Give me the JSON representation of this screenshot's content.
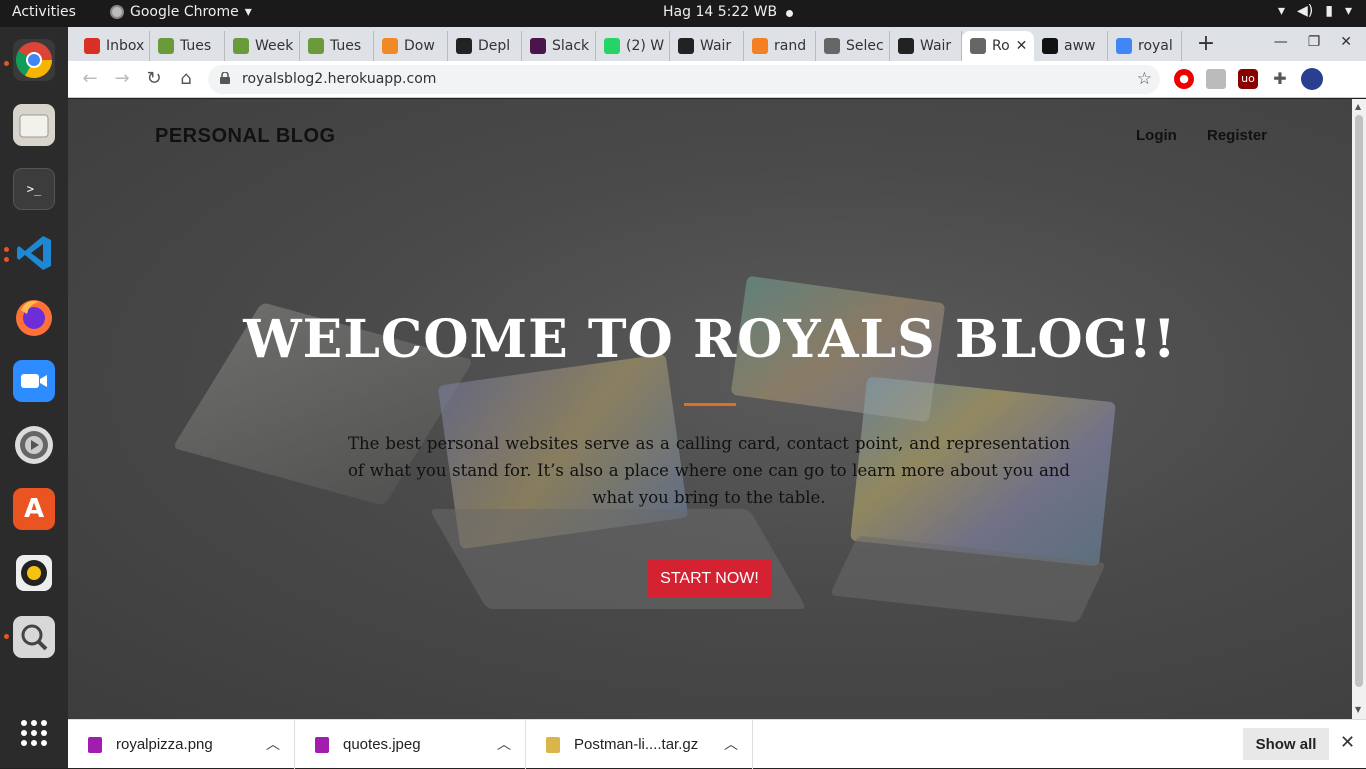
{
  "topbar": {
    "activities": "Activities",
    "app_name": "Google Chrome",
    "clock": "Hag 14   5:22 WB"
  },
  "dock": {
    "items": [
      "chrome-icon",
      "files-icon",
      "terminal-icon",
      "vscode-icon",
      "firefox-icon",
      "zoom-icon",
      "settings-icon",
      "software-icon",
      "music-icon",
      "screenshot-icon",
      "app-grid-icon"
    ]
  },
  "tabs": [
    {
      "label": "Inbox",
      "icon": "gmail-icon",
      "color": "#d93025"
    },
    {
      "label": "Tues",
      "icon": "palm-icon",
      "color": "#6a9a3a"
    },
    {
      "label": "Week",
      "icon": "palm-icon",
      "color": "#6a9a3a"
    },
    {
      "label": "Tues",
      "icon": "palm-icon",
      "color": "#6a9a3a"
    },
    {
      "label": "Dow",
      "icon": "download-site-icon",
      "color": "#f08a24"
    },
    {
      "label": "Depl",
      "icon": "github-icon",
      "color": "#222222"
    },
    {
      "label": "Slack",
      "icon": "slack-icon",
      "color": "#4a154b"
    },
    {
      "label": "(2) W",
      "icon": "whatsapp-icon",
      "color": "#25d366"
    },
    {
      "label": "Wair",
      "icon": "github-icon",
      "color": "#222222"
    },
    {
      "label": "rand",
      "icon": "stackoverflow-icon",
      "color": "#f48024"
    },
    {
      "label": "Selec",
      "icon": "globe-icon",
      "color": "#666666"
    },
    {
      "label": "Wair",
      "icon": "github-icon",
      "color": "#222222"
    },
    {
      "label": "Ro",
      "icon": "globe-icon",
      "color": "#666666"
    },
    {
      "label": "aww",
      "icon": "w-icon",
      "color": "#111111"
    },
    {
      "label": "royal",
      "icon": "google-icon",
      "color": "#4285f4"
    }
  ],
  "browser": {
    "url": "royalsblog2.herokuapp.com"
  },
  "site": {
    "brand": "PERSONAL BLOG",
    "login": "Login",
    "register": "Register",
    "hero_title": "WELCOME TO ROYALS BLOG!!",
    "hero_text": "The best personal websites serve as a calling card, contact point, and representation of what you stand for. It’s also a place where one can go to learn more about you and what you bring to the table.",
    "cta": "START NOW!",
    "accent_color": "#e36e1f",
    "button_color": "#d52233"
  },
  "downloads": {
    "items": [
      {
        "name": "royalpizza.png",
        "icon": "image-file-icon"
      },
      {
        "name": "quotes.jpeg",
        "icon": "image-file-icon"
      },
      {
        "name": "Postman-li....tar.gz",
        "icon": "archive-file-icon"
      }
    ],
    "show_all": "Show all"
  }
}
